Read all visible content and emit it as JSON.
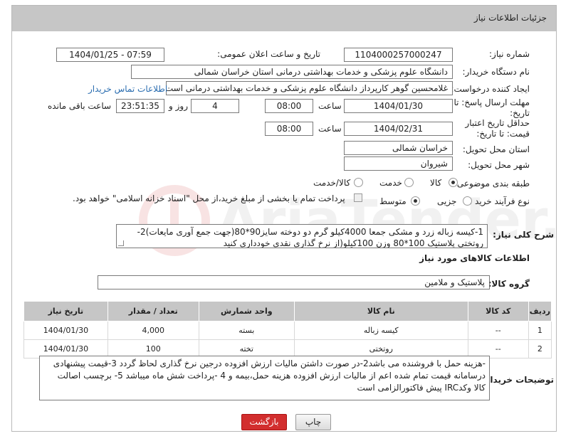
{
  "panel": {
    "title": "جزئیات اطلاعات نیاز"
  },
  "fields": {
    "need_number_label": "شماره نیاز:",
    "need_number": "1104000257000247",
    "announce_label": "تاریخ و ساعت اعلان عمومی:",
    "announce_value": "1404/01/25 - 07:59",
    "buyer_label": "نام دستگاه خریدار:",
    "buyer_value": "دانشگاه علوم پزشکی و خدمات بهداشتی درمانی استان خراسان شمالی",
    "creator_label": "ایجاد کننده درخواست:",
    "creator_value": "غلامحسین گوهر کارپرداز  دانشگاه علوم پزشکی و خدمات بهداشتی درمانی است",
    "contact_link": "اطلاعات تماس خریدار",
    "deadline_label": "مهلت ارسال پاسخ: تا تاریخ:",
    "deadline_date": "1404/01/30",
    "time_label": "ساعت",
    "deadline_time": "08:00",
    "days_value": "4",
    "days_label": "روز و",
    "remaining_time": "23:51:35",
    "remaining_label": "ساعت باقی مانده",
    "validity_label": "حداقل تاریخ اعتبار قیمت: تا تاریخ:",
    "validity_date": "1404/02/31",
    "validity_time": "08:00",
    "province_label": "استان محل تحویل:",
    "province_value": "خراسان شمالی",
    "city_label": "شهر محل تحویل:",
    "city_value": "شیروان",
    "category_label": "طبقه بندی موضوعی:",
    "category_options": [
      "کالا",
      "خدمت",
      "کالا/خدمت"
    ],
    "category_selected": "کالا",
    "process_label": "نوع فرآیند خرید :",
    "process_options": [
      "جزیی",
      "متوسط"
    ],
    "process_selected": "متوسط",
    "payment_note": "پرداخت تمام یا بخشی از مبلغ خرید،از محل \"اسناد خزانه اسلامی\" خواهد بود."
  },
  "description": {
    "label": "شرح کلی نیاز:",
    "text": "1-کیسه زباله زرد و مشکی جمعا 4000کیلو گرم  دو دوخته سایز90*80(جهت جمع آوری مایعات)2-روتختی پلاستیک 100*80  وزن 100کیلو(از نرخ گذاری نقدی خودداری کنید"
  },
  "goods": {
    "section_title": "اطلاعات کالاهای مورد نیاز",
    "group_label": "گروه کالا:",
    "group_value": "پلاستیک و ملامین",
    "columns": [
      "ردیف",
      "کد کالا",
      "نام کالا",
      "واحد شمارش",
      "تعداد / مقدار",
      "تاریخ نیاز"
    ],
    "rows": [
      [
        "1",
        "--",
        "کیسه زباله",
        "بسته",
        "4,000",
        "1404/01/30"
      ],
      [
        "2",
        "--",
        "روتختی",
        "تخته",
        "100",
        "1404/01/30"
      ]
    ]
  },
  "buyer_notes": {
    "label": "توضیحات خریدار:",
    "text": "-هزینه حمل با فروشنده می باشد2-در صورت داشتن مالیات ارزش افزوده درجین نرخ گذاری لحاظ گردد 3-قیمت پیشنهادی درسامانه  قیمت تمام شده اعم از مالیات ارزش افزوده هزینه حمل،بیمه و 4 -پرداخت شش ماه میباشد 5- برچسب اصالت کالا وکدIRC پیش فاکتورالزامی است"
  },
  "buttons": {
    "print": "چاپ",
    "back": "بازگشت"
  },
  "colors": {
    "header_bg": "#c6c6c6",
    "link": "#2a6db0",
    "back_button": "#d22e2e"
  },
  "watermark": {
    "text": "AriaTender.net"
  }
}
